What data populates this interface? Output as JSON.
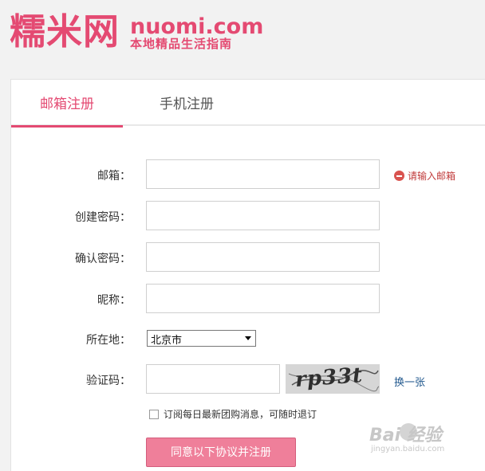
{
  "brand": {
    "name": "糯米网",
    "domain": "nuomi.com",
    "slogan": "本地精品生活指南",
    "color": "#e44a72"
  },
  "tabs": [
    {
      "label": "邮箱注册",
      "active": true
    },
    {
      "label": "手机注册",
      "active": false
    }
  ],
  "form": {
    "email": {
      "label": "邮箱：",
      "value": "",
      "tip": "请输入邮箱",
      "tip_icon": "minus-circle-icon"
    },
    "password": {
      "label": "创建密码：",
      "value": ""
    },
    "confirm": {
      "label": "确认密码：",
      "value": ""
    },
    "nickname": {
      "label": "昵称：",
      "value": ""
    },
    "location": {
      "label": "所在地：",
      "selected": "北京市"
    },
    "captcha": {
      "label": "验证码：",
      "value": "",
      "image_text": "rp33t",
      "refresh": "换一张"
    },
    "subscribe": {
      "label": "订阅每日最新团购消息，可随时退订",
      "checked": false
    },
    "submit": "同意以下协议并注册"
  },
  "watermark": {
    "text": "Bai  经验",
    "url": "jingyan.baidu.com"
  }
}
